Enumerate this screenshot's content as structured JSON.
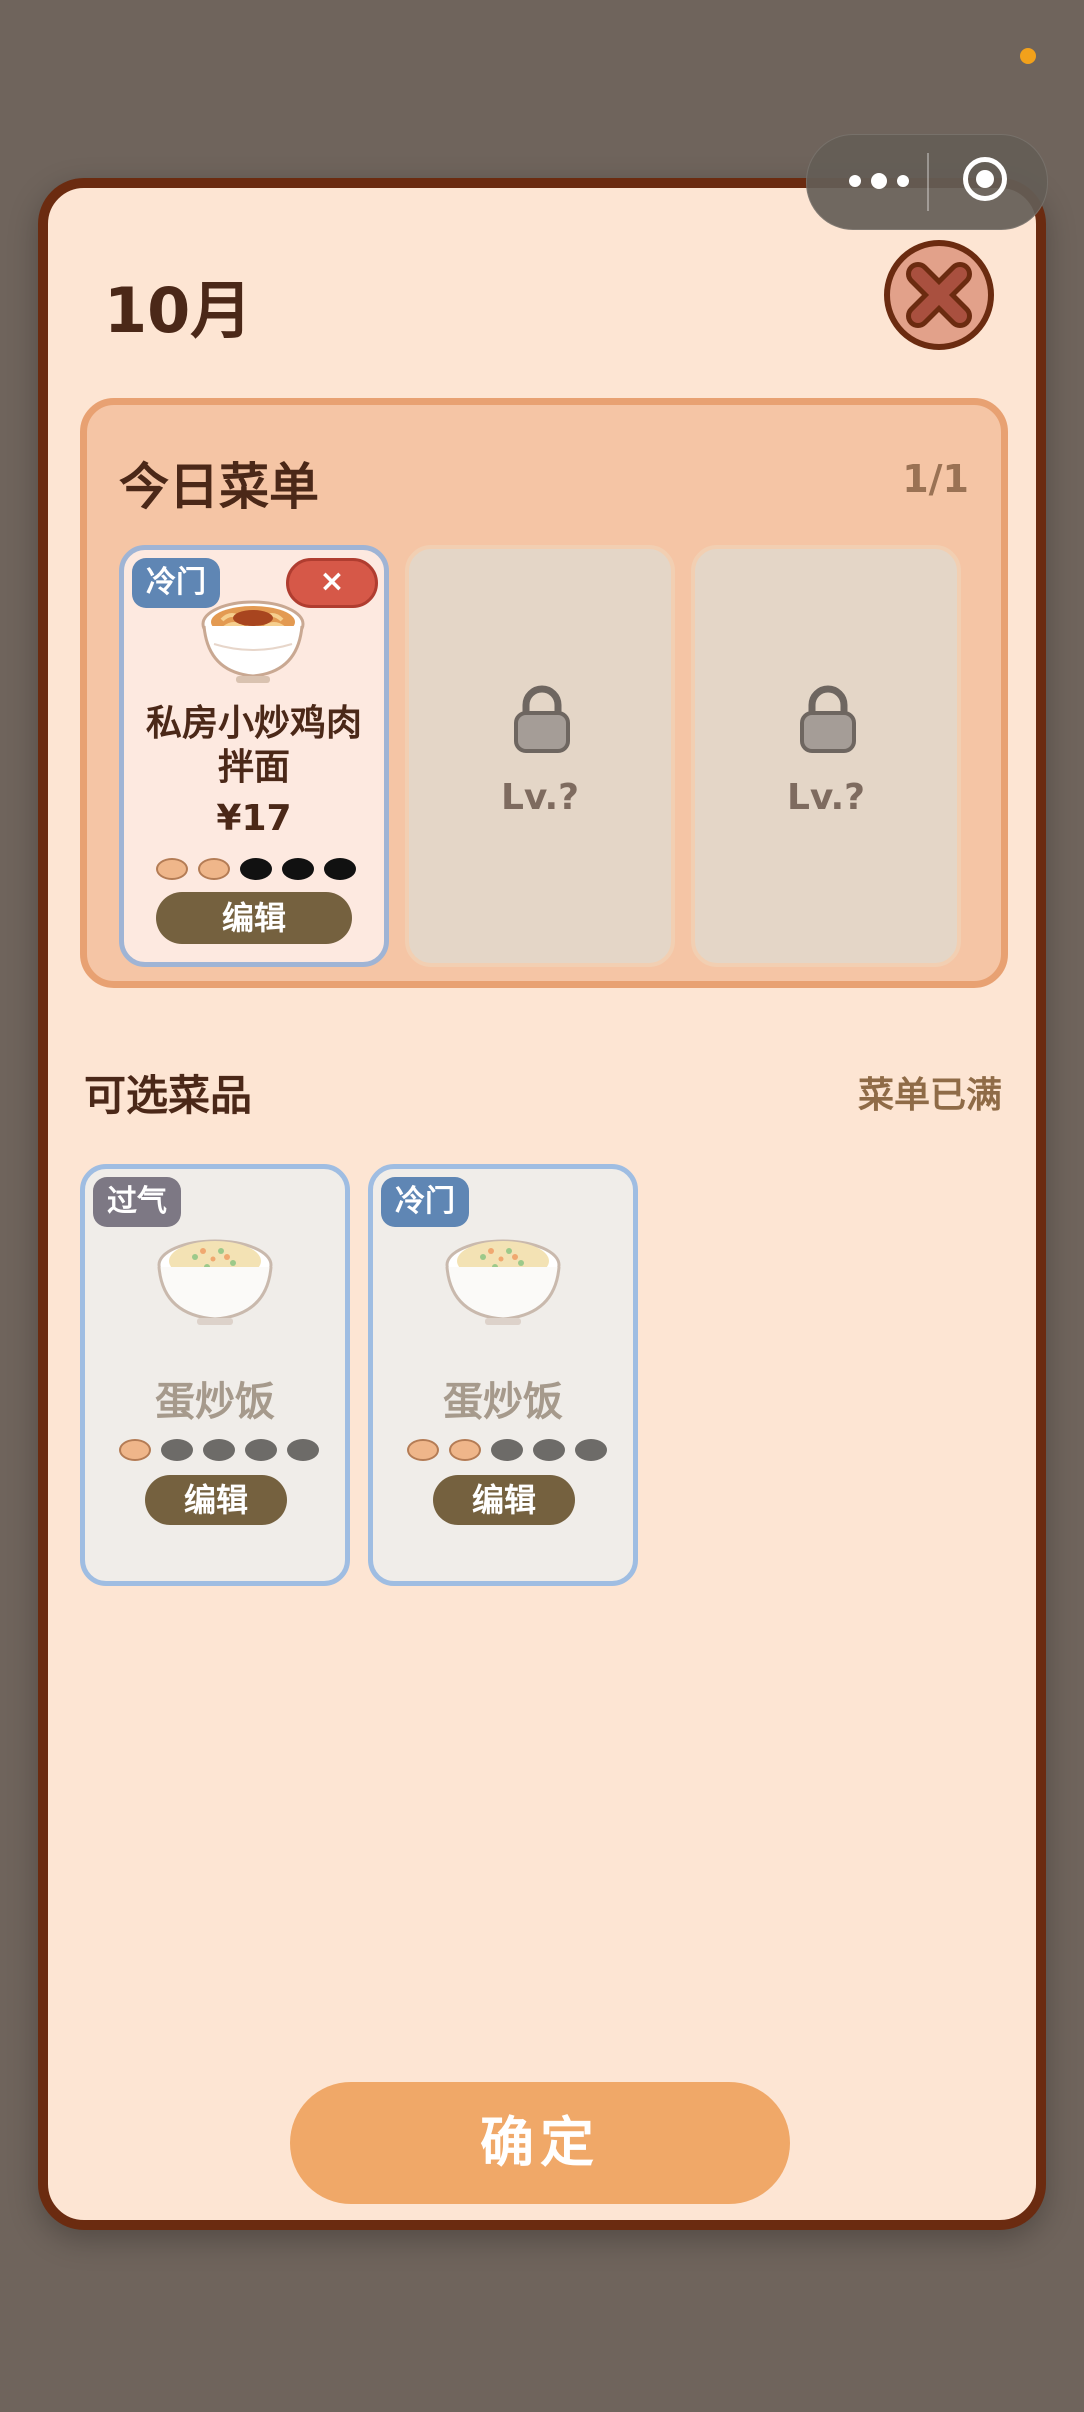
{
  "header": {
    "title": "10月"
  },
  "today_menu": {
    "title": "今日菜单",
    "count": "1/1",
    "selected": [
      {
        "tag": "冷门",
        "remove_label": "×",
        "name": "私房小炒鸡肉拌面",
        "price": "¥17",
        "rating": 2,
        "rating_max": 5,
        "edit_label": "编辑"
      }
    ],
    "locked_slots": [
      {
        "label": "Lv.?"
      },
      {
        "label": "Lv.?"
      }
    ]
  },
  "available": {
    "title": "可选菜品",
    "status": "菜单已满",
    "items": [
      {
        "tag": "过气",
        "name": "蛋炒饭",
        "rating": 1,
        "rating_max": 5,
        "edit_label": "编辑"
      },
      {
        "tag": "冷门",
        "name": "蛋炒饭",
        "rating": 2,
        "rating_max": 5,
        "edit_label": "编辑"
      }
    ]
  },
  "footer": {
    "confirm_label": "确定"
  },
  "colors": {
    "accent": "#f0a868",
    "tag_blue": "#5f86b4",
    "tag_gray": "#7d7884",
    "remove_red": "#d65848",
    "frame_brown": "#6b2b10"
  }
}
